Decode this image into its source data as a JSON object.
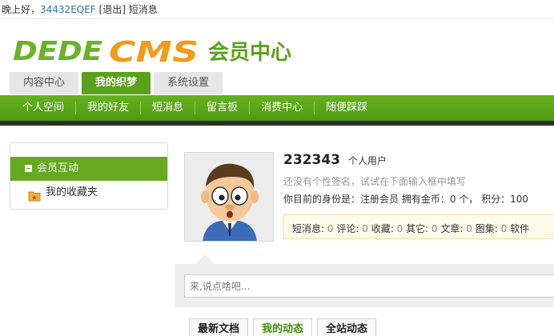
{
  "topbar": {
    "greeting": "晚上好，",
    "username": "34432EQEF",
    "logout": "[退出]",
    "messages": "短消息"
  },
  "header": {
    "logo_text_1": "DEDE",
    "logo_text_2": "CMS",
    "logo_subtitle": "会员中心",
    "tabs": [
      {
        "label": "内容中心",
        "active": false
      },
      {
        "label": "我的织梦",
        "active": true
      },
      {
        "label": "系统设置",
        "active": false
      }
    ]
  },
  "nav": {
    "items": [
      "个人空间",
      "我的好友",
      "短消息",
      "留言板",
      "消费中心",
      "随便踩踩"
    ]
  },
  "sidebar": {
    "active_label": "会员互动",
    "items": [
      "我的收藏夹"
    ]
  },
  "profile": {
    "name": "232343",
    "role": "个人用户",
    "signature": "还没有个性签名，试试在下面输入框中填写",
    "identity": "你目前的身份是：注册会员 拥有金币：0 个， 积分：100",
    "stats": [
      {
        "label": "短消息:",
        "value": "0"
      },
      {
        "label": "评论:",
        "value": "0"
      },
      {
        "label": "收藏:",
        "value": "0"
      },
      {
        "label": "其它:",
        "value": "0"
      },
      {
        "label": "文章:",
        "value": "0"
      },
      {
        "label": "图集:",
        "value": "0"
      },
      {
        "label": "软件",
        "value": ""
      }
    ]
  },
  "post": {
    "placeholder": "来,说点啥吧..."
  },
  "bottom_tabs": [
    {
      "label": "最新文档",
      "active": false
    },
    {
      "label": "我的动态",
      "active": true
    },
    {
      "label": "全站动态",
      "active": false
    }
  ],
  "colors": {
    "brand_green": "#5aa219",
    "logo_orange": "#f39a17",
    "link_blue": "#2f6fb1"
  }
}
